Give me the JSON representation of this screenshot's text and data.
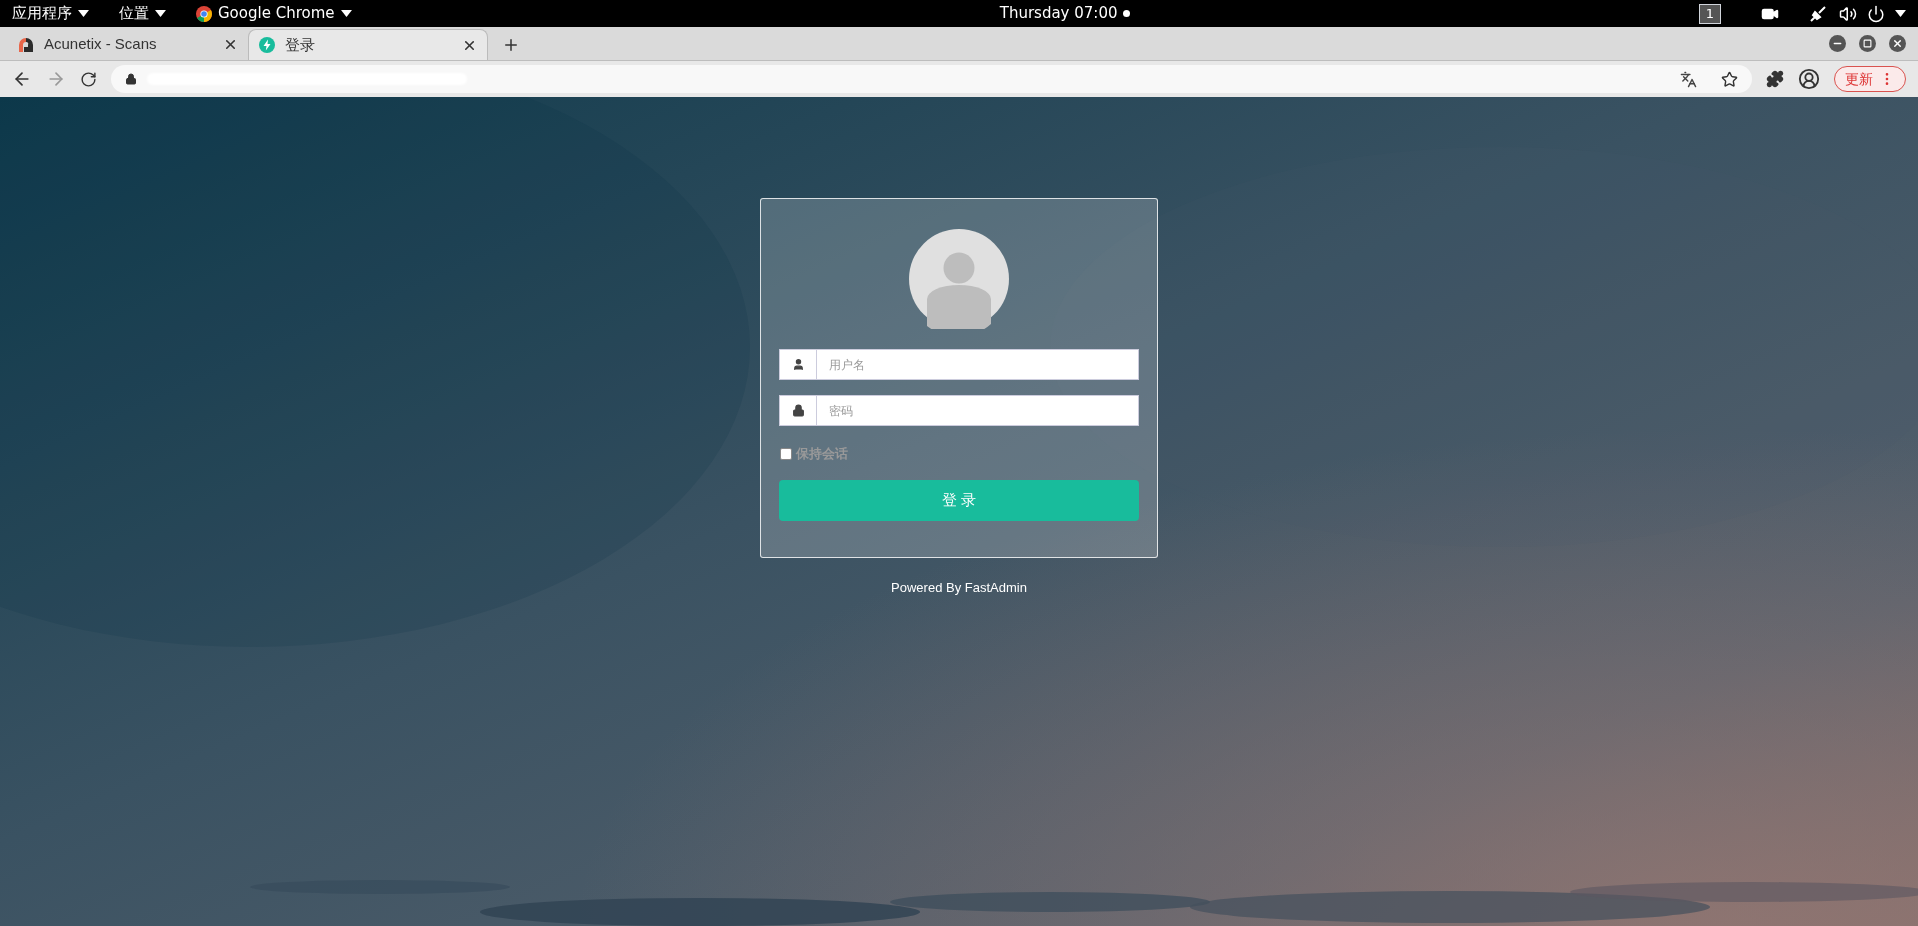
{
  "top_bar": {
    "menus": [
      {
        "label": "应用程序",
        "kind": "plain"
      },
      {
        "label": "位置",
        "kind": "plain"
      },
      {
        "label": "Google Chrome",
        "kind": "app"
      }
    ],
    "clock": "Thursday 07:00",
    "workspace": "1"
  },
  "tabs": [
    {
      "title": "Acunetix - Scans",
      "kind": "scanner",
      "selected": false
    },
    {
      "title": "登录",
      "kind": "bolt",
      "selected": true
    }
  ],
  "address_bar": {
    "update_button": "更新"
  },
  "login": {
    "username": {
      "placeholder": "用户名"
    },
    "password": {
      "placeholder": "密码"
    },
    "remember": {
      "label": "保持会话",
      "checked": false
    },
    "submit": "登 录",
    "footer": "Powered By FastAdmin"
  }
}
